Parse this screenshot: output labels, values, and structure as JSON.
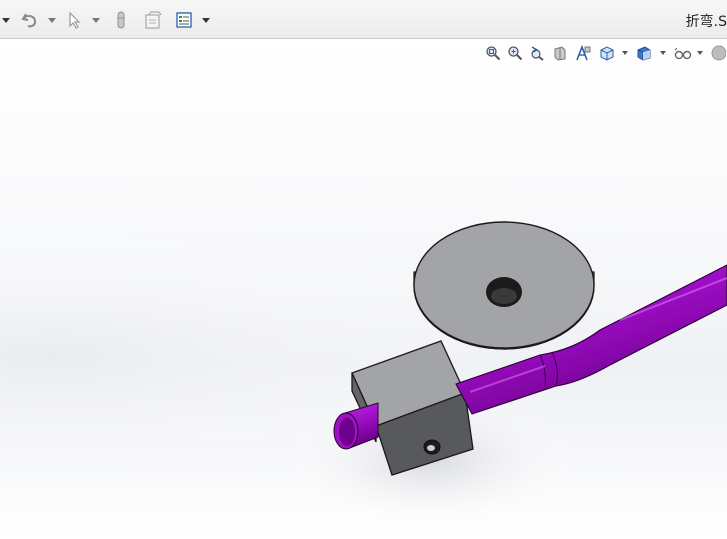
{
  "window": {
    "title": "折弯.S"
  },
  "toolbar": {
    "items": [
      {
        "icon": "dropdown-arrow-icon"
      },
      {
        "icon": "undo-icon"
      },
      {
        "icon": "dropdown-arrow-icon"
      },
      {
        "icon": "select-pointer-icon"
      },
      {
        "icon": "dropdown-arrow-icon"
      },
      {
        "icon": "rebuild-icon"
      },
      {
        "icon": "file-properties-icon"
      },
      {
        "icon": "options-icon"
      },
      {
        "icon": "dropdown-arrow-icon"
      }
    ]
  },
  "heads_up_toolbar": {
    "items": [
      {
        "icon": "zoom-to-fit-icon"
      },
      {
        "icon": "zoom-to-area-icon"
      },
      {
        "icon": "previous-view-icon"
      },
      {
        "icon": "section-view-icon"
      },
      {
        "icon": "dynamic-annotation-views-icon"
      },
      {
        "icon": "view-orientation-icon"
      },
      {
        "icon": "display-style-icon"
      },
      {
        "icon": "hide-show-items-icon"
      },
      {
        "icon": "appearance-icon"
      }
    ]
  },
  "colors": {
    "tube": "#a010c8",
    "tube_dark": "#5a0070",
    "die_face": "#a2a4a8",
    "die_side": "#5c5d60",
    "toolbar_bg": "#efefef",
    "icon_blue": "#2a5fb0"
  },
  "model": {
    "name": "pipe-bending-fixture"
  }
}
